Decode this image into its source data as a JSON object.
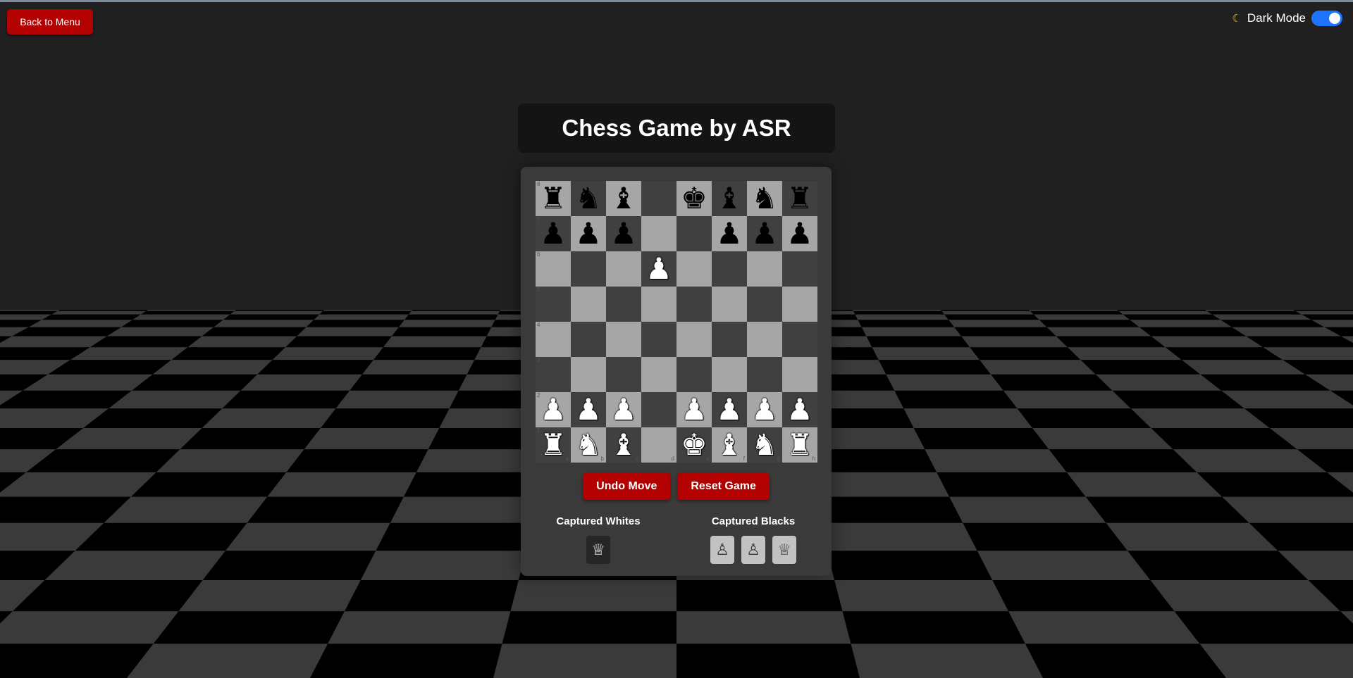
{
  "header": {
    "back_label": "Back to Menu",
    "dark_mode_icon": "☾",
    "dark_mode_label": "Dark Mode",
    "dark_mode_on": true
  },
  "title": "Chess Game by ASR",
  "board": {
    "light_color": "#a6a6a6",
    "dark_color": "#404040",
    "files": [
      "a",
      "b",
      "c",
      "d",
      "e",
      "f",
      "g",
      "h"
    ],
    "ranks": [
      "8",
      "7",
      "6",
      "5",
      "4",
      "3",
      "2",
      "1"
    ],
    "rows": [
      [
        {
          "p": "♜",
          "c": "black"
        },
        {
          "p": "♞",
          "c": "black"
        },
        {
          "p": "♝",
          "c": "black"
        },
        {
          "p": "",
          "c": ""
        },
        {
          "p": "♚",
          "c": "black"
        },
        {
          "p": "♝",
          "c": "black"
        },
        {
          "p": "♞",
          "c": "black"
        },
        {
          "p": "♜",
          "c": "black"
        }
      ],
      [
        {
          "p": "♟",
          "c": "black"
        },
        {
          "p": "♟",
          "c": "black"
        },
        {
          "p": "♟",
          "c": "black"
        },
        {
          "p": "",
          "c": ""
        },
        {
          "p": "",
          "c": ""
        },
        {
          "p": "♟",
          "c": "black"
        },
        {
          "p": "♟",
          "c": "black"
        },
        {
          "p": "♟",
          "c": "black"
        }
      ],
      [
        {
          "p": "",
          "c": ""
        },
        {
          "p": "",
          "c": ""
        },
        {
          "p": "",
          "c": ""
        },
        {
          "p": "♟",
          "c": "white"
        },
        {
          "p": "",
          "c": ""
        },
        {
          "p": "",
          "c": ""
        },
        {
          "p": "",
          "c": ""
        },
        {
          "p": "",
          "c": ""
        }
      ],
      [
        {
          "p": "",
          "c": ""
        },
        {
          "p": "",
          "c": ""
        },
        {
          "p": "",
          "c": ""
        },
        {
          "p": "",
          "c": ""
        },
        {
          "p": "",
          "c": ""
        },
        {
          "p": "",
          "c": ""
        },
        {
          "p": "",
          "c": ""
        },
        {
          "p": "",
          "c": ""
        }
      ],
      [
        {
          "p": "",
          "c": ""
        },
        {
          "p": "",
          "c": ""
        },
        {
          "p": "",
          "c": ""
        },
        {
          "p": "",
          "c": ""
        },
        {
          "p": "",
          "c": ""
        },
        {
          "p": "",
          "c": ""
        },
        {
          "p": "",
          "c": ""
        },
        {
          "p": "",
          "c": ""
        }
      ],
      [
        {
          "p": "",
          "c": ""
        },
        {
          "p": "",
          "c": ""
        },
        {
          "p": "",
          "c": ""
        },
        {
          "p": "",
          "c": ""
        },
        {
          "p": "",
          "c": ""
        },
        {
          "p": "",
          "c": ""
        },
        {
          "p": "",
          "c": ""
        },
        {
          "p": "",
          "c": ""
        }
      ],
      [
        {
          "p": "♟",
          "c": "white"
        },
        {
          "p": "♟",
          "c": "white"
        },
        {
          "p": "♟",
          "c": "white"
        },
        {
          "p": "",
          "c": ""
        },
        {
          "p": "♟",
          "c": "white"
        },
        {
          "p": "♟",
          "c": "white"
        },
        {
          "p": "♟",
          "c": "white"
        },
        {
          "p": "♟",
          "c": "white"
        }
      ],
      [
        {
          "p": "♜",
          "c": "white"
        },
        {
          "p": "♞",
          "c": "white"
        },
        {
          "p": "♝",
          "c": "white"
        },
        {
          "p": "",
          "c": ""
        },
        {
          "p": "♚",
          "c": "white"
        },
        {
          "p": "♝",
          "c": "white"
        },
        {
          "p": "♞",
          "c": "white"
        },
        {
          "p": "♜",
          "c": "white"
        }
      ]
    ]
  },
  "controls": {
    "undo_label": "Undo Move",
    "reset_label": "Reset Game"
  },
  "captured": {
    "whites_label": "Captured Whites",
    "whites": [
      "♕"
    ],
    "blacks_label": "Captured Blacks",
    "blacks": [
      "♙",
      "♙",
      "♕"
    ]
  },
  "colors": {
    "accent_red": "#b30000",
    "toggle_blue": "#1e74ff",
    "background": "#202020"
  }
}
